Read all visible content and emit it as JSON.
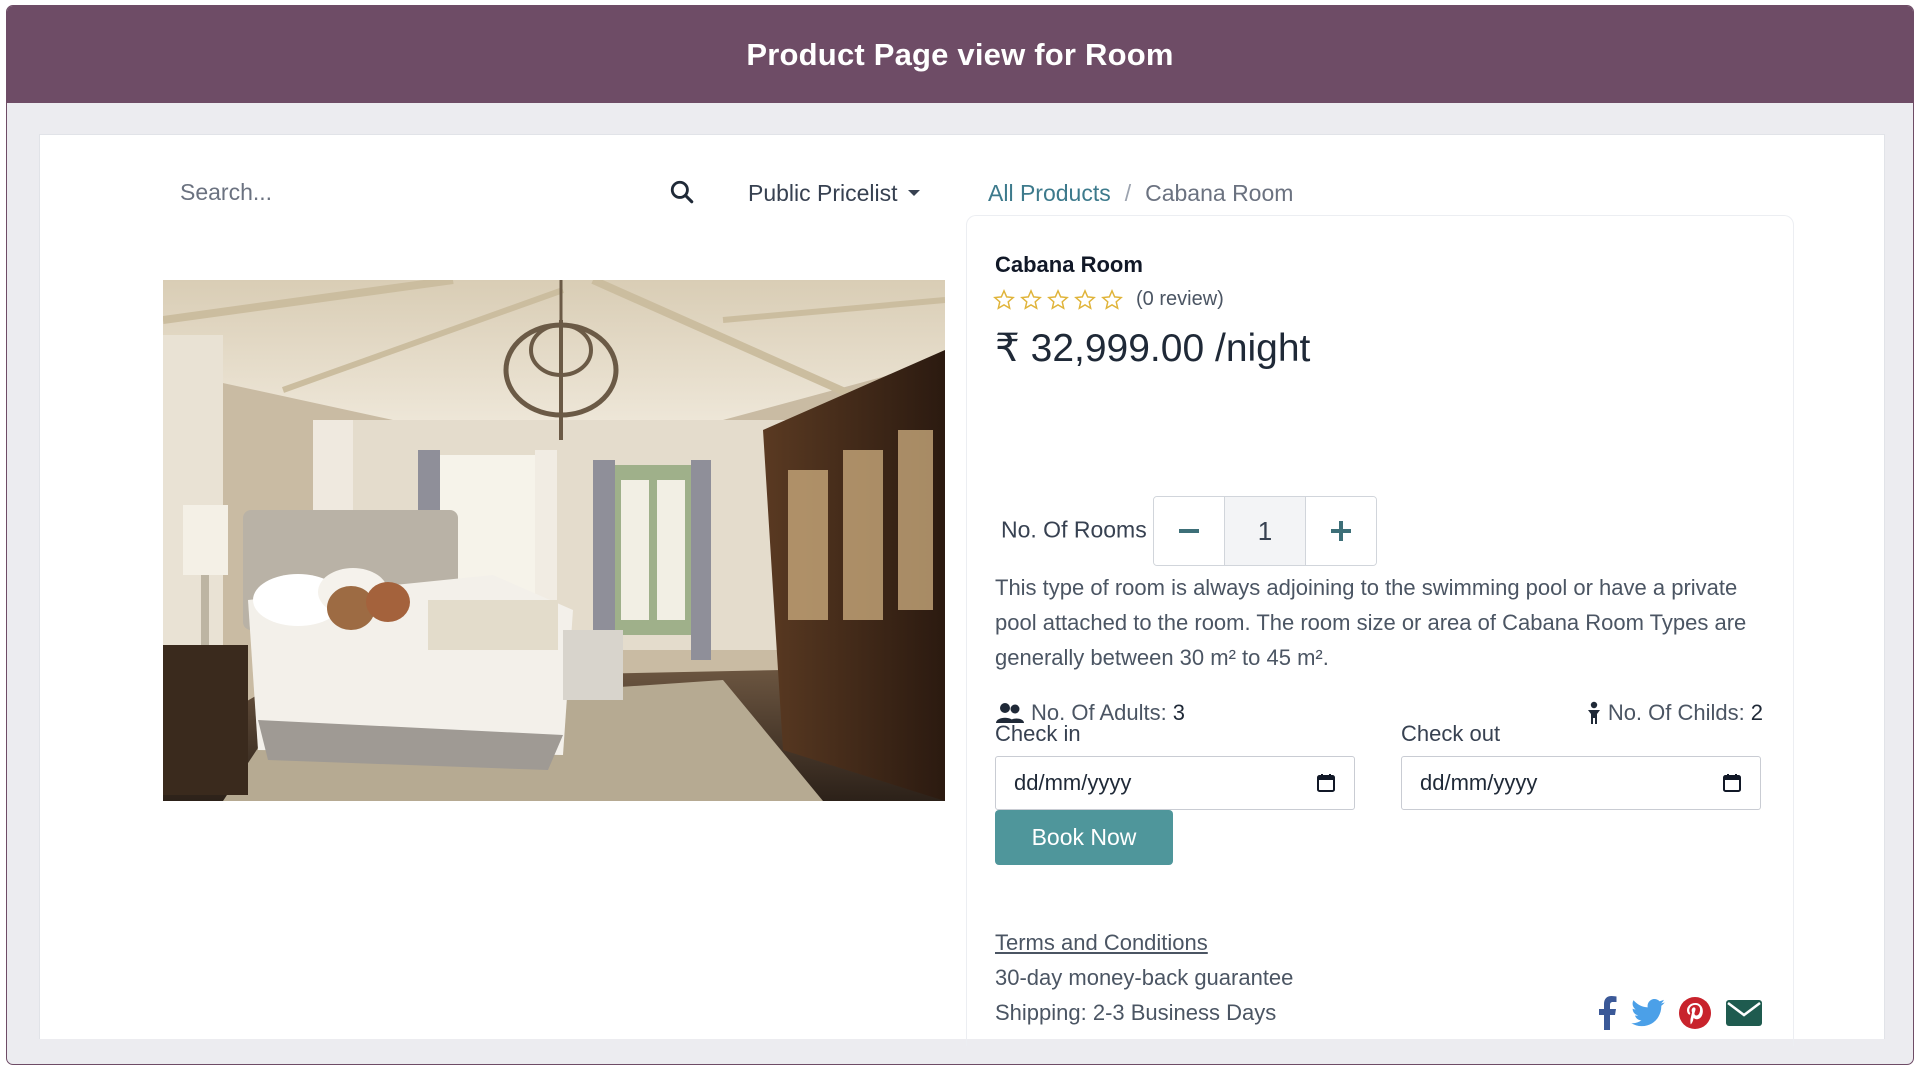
{
  "banner": {
    "title": "Product Page view for Room"
  },
  "search": {
    "placeholder": "Search..."
  },
  "pricelist": {
    "label": "Public Pricelist"
  },
  "breadcrumb": {
    "parent": "All Products",
    "separator": "/",
    "current": "Cabana Room"
  },
  "product": {
    "name": "Cabana Room",
    "rating": {
      "stars": 0,
      "max_stars": 5,
      "review_text": "(0 review)"
    },
    "price": "₹ 32,999.00 /night",
    "rooms": {
      "label": "No. Of Rooms",
      "quantity": "1"
    },
    "description": "This type of room is always adjoining to the swimming pool or have a private pool attached to the room. The room size or area of Cabana Room Types are generally between 30 m² to 45 m².",
    "adults": {
      "label": "No. Of Adults:",
      "value": "3"
    },
    "childs": {
      "label": "No. Of Childs:",
      "value": "2"
    }
  },
  "booking": {
    "checkin_label": "Check in",
    "checkout_label": "Check out",
    "date_placeholder": "dd/mm/yyyy",
    "book_button": "Book Now"
  },
  "footer": {
    "terms": "Terms and Conditions",
    "guarantee": "30-day money-back guarantee",
    "shipping": "Shipping: 2-3 Business Days"
  },
  "share_icons": [
    "facebook-icon",
    "twitter-icon",
    "pinterest-icon",
    "email-icon"
  ],
  "colors": {
    "banner": "#6e4c66",
    "accent": "#4f969b",
    "link": "#3d7a8c",
    "star": "#e0b43a",
    "facebook": "#3b5998",
    "twitter": "#4ba0e8",
    "pinterest": "#c8232c",
    "email": "#1f5b4f"
  }
}
